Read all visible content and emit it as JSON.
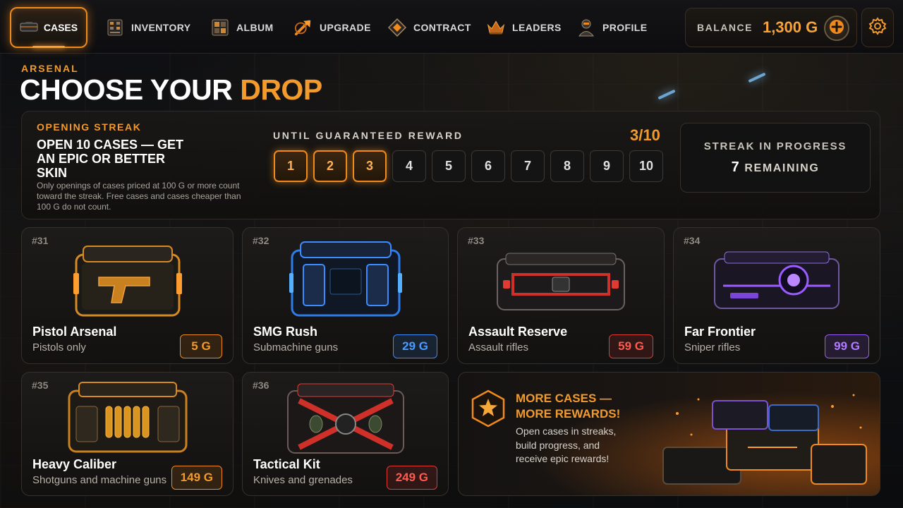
{
  "nav": {
    "active": {
      "label": "CASES",
      "icon": "case-icon"
    },
    "items": [
      {
        "label": "INVENTORY",
        "icon": "inventory-icon"
      },
      {
        "label": "ALBUM",
        "icon": "album-icon"
      },
      {
        "label": "UPGRADE",
        "icon": "upgrade-icon"
      },
      {
        "label": "CONTRACT",
        "icon": "contract-icon"
      },
      {
        "label": "LEADERS",
        "icon": "crown-icon"
      },
      {
        "label": "PROFILE",
        "icon": "profile-icon"
      }
    ],
    "balance_label": "BALANCE",
    "balance_value": "1,300 G"
  },
  "header": {
    "eyebrow": "ARSENAL",
    "title_main": "CHOOSE YOUR",
    "title_accent": "DROP"
  },
  "streak": {
    "label": "OPENING STREAK",
    "title": "OPEN 10 CASES — GET AN EPIC OR BETTER SKIN",
    "description": "Only openings of cases priced at 100 G or more count toward the streak. Free cases and cases cheaper than 100 G do not count.",
    "until_label": "UNTIL GUARANTEED REWARD",
    "progress_text": "3/10",
    "progress_done": 3,
    "steps": [
      "1",
      "2",
      "3",
      "4",
      "5",
      "6",
      "7",
      "8",
      "9",
      "10"
    ],
    "status_title": "STREAK IN PROGRESS",
    "status_count": "7",
    "status_suffix": "REMAINING"
  },
  "cases": [
    {
      "id": "#31",
      "name": "Pistol Arsenal",
      "sub": "Pistols only",
      "price": "5 G",
      "color": "#f08a1c",
      "theme": "gold"
    },
    {
      "id": "#32",
      "name": "SMG Rush",
      "sub": "Submachine guns",
      "price": "29 G",
      "color": "#3a8cff",
      "theme": "blue"
    },
    {
      "id": "#33",
      "name": "Assault Reserve",
      "sub": "Assault rifles",
      "price": "59 G",
      "color": "#e03a32",
      "theme": "red"
    },
    {
      "id": "#34",
      "name": "Far Frontier",
      "sub": "Sniper rifles",
      "price": "99 G",
      "color": "#9b5cff",
      "theme": "purple"
    },
    {
      "id": "#35",
      "name": "Heavy Caliber",
      "sub": "Shotguns and machine guns",
      "price": "149 G",
      "color": "#f08a1c",
      "theme": "gold"
    },
    {
      "id": "#36",
      "name": "Tactical Kit",
      "sub": "Knives and grenades",
      "price": "249 G",
      "color": "#e03a32",
      "theme": "red"
    }
  ],
  "promo": {
    "title": "MORE CASES — MORE REWARDS!",
    "description": "Open cases in streaks, build progress, and receive epic rewards!",
    "icon": "star-badge-icon"
  }
}
